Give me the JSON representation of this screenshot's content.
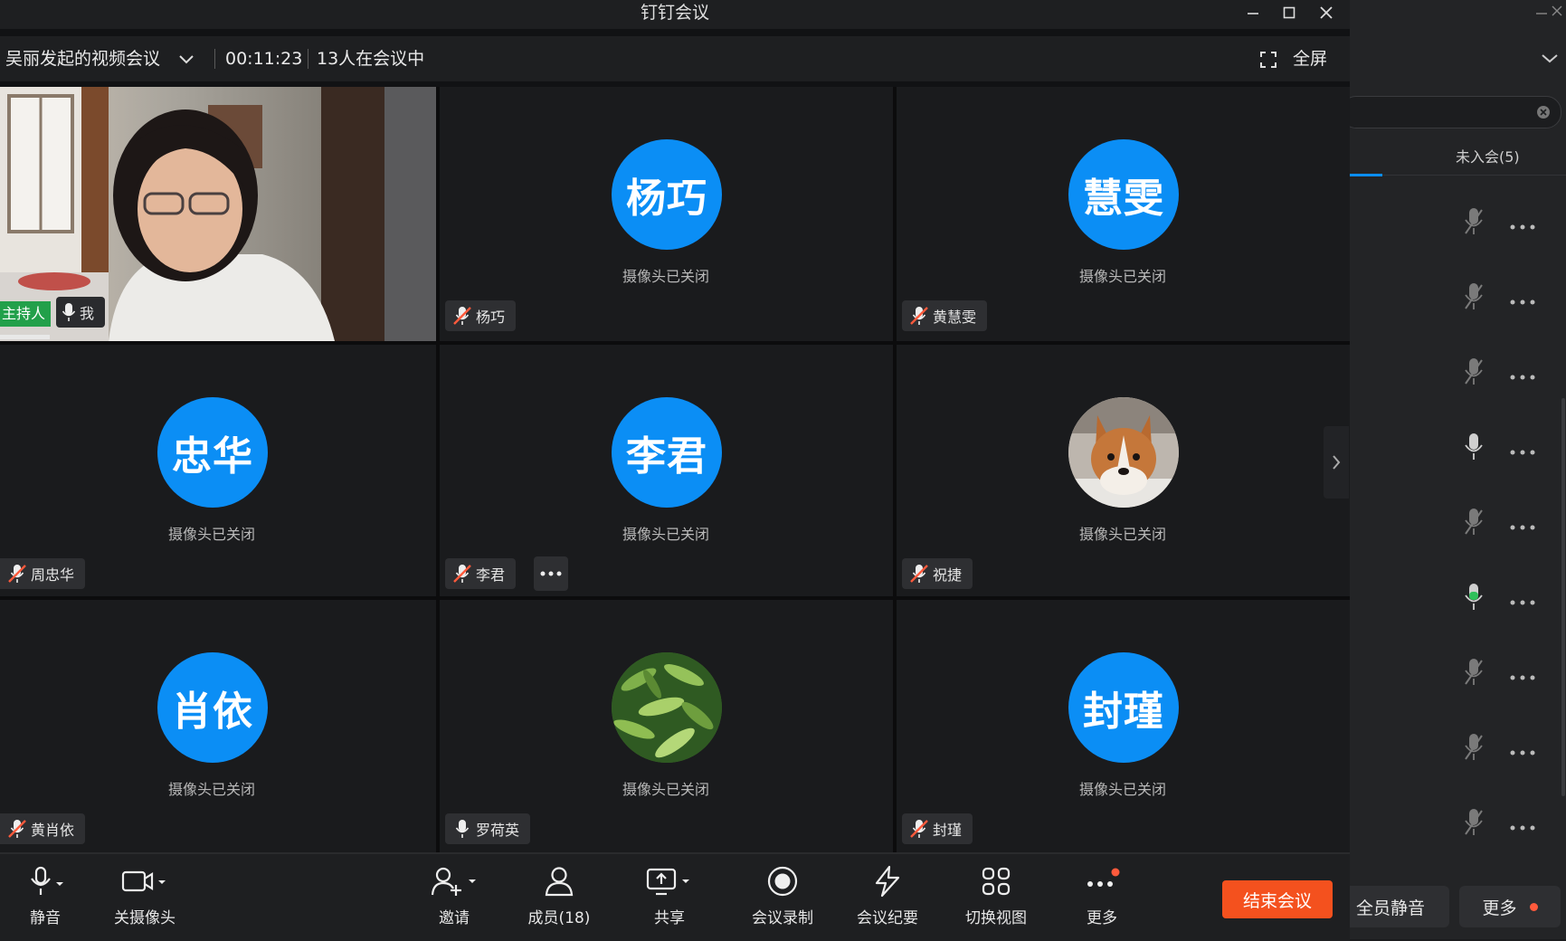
{
  "window": {
    "title": "钉钉会议"
  },
  "meeting": {
    "topic": "吴丽发起的视频会议",
    "duration": "00:11:23",
    "attendees": "13人在会议中",
    "fullscreen_label": "全屏"
  },
  "tiles": [
    {
      "id": "me",
      "name": "我",
      "host_badge": "主持人",
      "video": true,
      "mic": "on"
    },
    {
      "id": "yangqiao",
      "name": "杨巧",
      "avatar_text": "杨巧",
      "status": "摄像头已关闭",
      "mic": "muted"
    },
    {
      "id": "huanghuiwen",
      "name": "黄慧雯",
      "avatar_text": "慧雯",
      "status": "摄像头已关闭",
      "mic": "muted"
    },
    {
      "id": "zhouzhonghua",
      "name": "周忠华",
      "avatar_text": "忠华",
      "status": "摄像头已关闭",
      "mic": "muted"
    },
    {
      "id": "lijun",
      "name": "李君",
      "avatar_text": "李君",
      "status": "摄像头已关闭",
      "mic": "muted"
    },
    {
      "id": "zhujie",
      "name": "祝捷",
      "avatar_image": "corgi-dog-photo",
      "status": "摄像头已关闭",
      "mic": "muted"
    },
    {
      "id": "huangxiaoyi",
      "name": "黄肖依",
      "avatar_text": "肖依",
      "status": "摄像头已关闭",
      "mic": "muted"
    },
    {
      "id": "luohefu",
      "name": "罗荷英",
      "avatar_image": "green-leaves-photo",
      "status": "摄像头已关闭",
      "mic": "on"
    },
    {
      "id": "fengjin",
      "name": "封瑾",
      "avatar_text": "封瑾",
      "status": "摄像头已关闭",
      "mic": "muted"
    }
  ],
  "toolbar": {
    "mute": "静音",
    "camera": "关摄像头",
    "invite": "邀请",
    "members": "成员(18)",
    "share": "共享",
    "record": "会议录制",
    "minutes": "会议纪要",
    "switch_view": "切换视图",
    "more": "更多",
    "end": "结束会议"
  },
  "panel": {
    "tab_not_joined": "未入会(5)",
    "mute_all": "全员静音",
    "more": "更多",
    "rows": [
      {
        "mic": "muted"
      },
      {
        "mic": "muted"
      },
      {
        "mic": "muted"
      },
      {
        "mic": "on"
      },
      {
        "mic": "muted"
      },
      {
        "mic": "speaking"
      },
      {
        "mic": "muted"
      },
      {
        "mic": "muted"
      },
      {
        "mic": "muted"
      }
    ]
  },
  "colors": {
    "accent_blue": "#0b8ef5",
    "host_green": "#22a04a",
    "end_red": "#f4511e",
    "mute_red": "#ff5a3c",
    "speaking_green": "#2fbf5a"
  }
}
